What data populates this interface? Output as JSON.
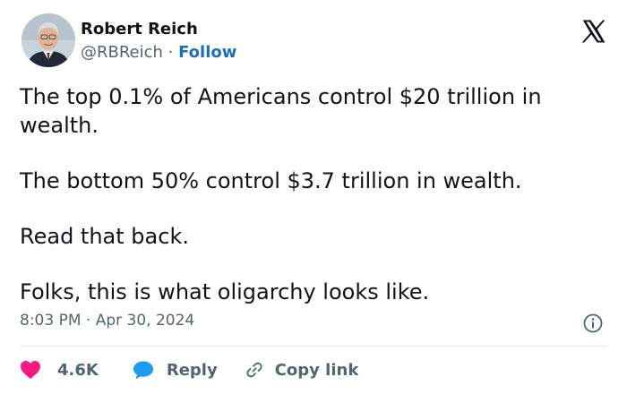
{
  "author": {
    "name": "Robert Reich",
    "handle": "@RBReich",
    "separator": " · ",
    "follow_label": "Follow"
  },
  "tweet": {
    "paragraphs": [
      "The top 0.1% of Americans control $20 trillion in wealth.",
      "The bottom 50% control $3.7 trillion in wealth.",
      "Read that back.",
      "Folks, this is what oligarchy looks like."
    ],
    "timestamp": "8:03 PM · Apr 30, 2024"
  },
  "actions": {
    "like_count": "4.6K",
    "reply_label": "Reply",
    "copy_label": "Copy link"
  },
  "icons": {
    "logo": "x-logo-icon",
    "info": "info-icon",
    "like": "heart-icon",
    "reply": "speech-bubble-icon",
    "copy": "link-icon"
  },
  "colors": {
    "text": "#0f1419",
    "secondary": "#536471",
    "follow": "#1d6fb8",
    "heart": "#f91880",
    "reply_bubble": "#1d9bf0"
  }
}
